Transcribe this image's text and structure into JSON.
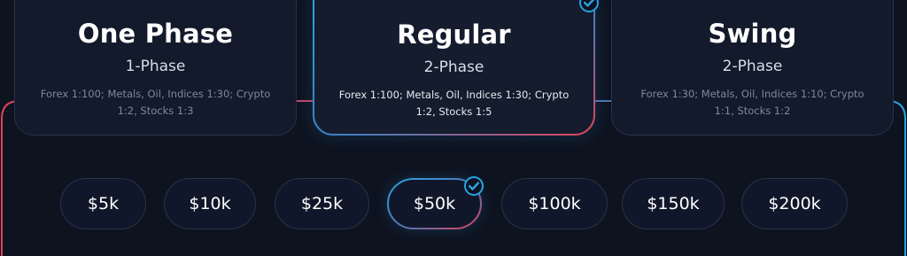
{
  "plans": [
    {
      "title": "One Phase",
      "subtitle": "1-Phase",
      "desc": "Forex 1:100; Metals, Oil, Indices 1:30; Crypto 1:2, Stocks 1:3",
      "selected": false
    },
    {
      "title": "Regular",
      "subtitle": "2-Phase",
      "desc": "Forex 1:100; Metals, Oil, Indices 1:30; Crypto 1:2, Stocks 1:5",
      "selected": true
    },
    {
      "title": "Swing",
      "subtitle": "2-Phase",
      "desc": "Forex 1:30; Metals, Oil, Indices 1:10; Crypto 1:1, Stocks 1:2",
      "selected": false
    }
  ],
  "amounts": [
    {
      "label": "$5k",
      "selected": false
    },
    {
      "label": "$10k",
      "selected": false
    },
    {
      "label": "$25k",
      "selected": false
    },
    {
      "label": "$50k",
      "selected": true
    },
    {
      "label": "$100k",
      "selected": false
    },
    {
      "label": "$150k",
      "selected": false
    },
    {
      "label": "$200k",
      "selected": false
    }
  ],
  "colors": {
    "accent_blue": "#2aa3e0",
    "accent_red": "#e0435a",
    "background": "#0e1320"
  },
  "icons": {
    "selected_marker": "checkmark-icon"
  }
}
